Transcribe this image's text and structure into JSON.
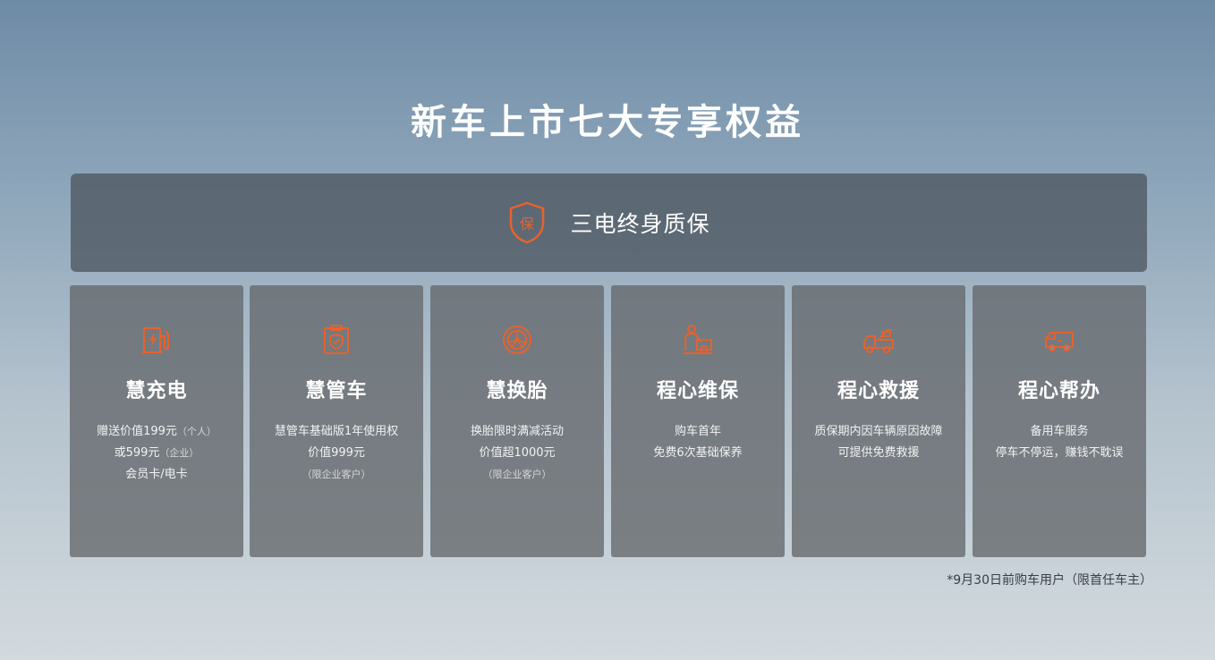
{
  "page": {
    "title": "新车上市七大专享权益",
    "accent_color": "#e8622c",
    "footnote": "*9月30日前购车用户（限首任车主）"
  },
  "banner": {
    "icon": "shield-guarantee-icon",
    "icon_glyph": "保",
    "label": "三电终身质保"
  },
  "cards": [
    {
      "icon": "charging-station-icon",
      "title": "慧充电",
      "line1": "赠送价值199元",
      "line1_note": "（个人）",
      "line2": "或599元",
      "line2_note": "（企业）",
      "line3": "会员卡/电卡"
    },
    {
      "icon": "clipboard-shield-icon",
      "title": "慧管车",
      "line1": "慧管车基础版1年使用权",
      "line2": "价值999元",
      "note": "（限企业客户）"
    },
    {
      "icon": "tire-icon",
      "title": "慧换胎",
      "line1": "换胎限时满减活动",
      "line2": "价值超1000元",
      "note": "（限企业客户）"
    },
    {
      "icon": "mechanic-repair-icon",
      "title": "程心维保",
      "line1": "购车首年",
      "line2": "免费6次基础保养"
    },
    {
      "icon": "tow-truck-icon",
      "title": "程心救援",
      "line1": "质保期内因车辆原因故障",
      "line2": "可提供免费救援"
    },
    {
      "icon": "van-icon",
      "title": "程心帮办",
      "line1": "备用车服务",
      "line2": "停车不停运，赚钱不耽误"
    }
  ]
}
